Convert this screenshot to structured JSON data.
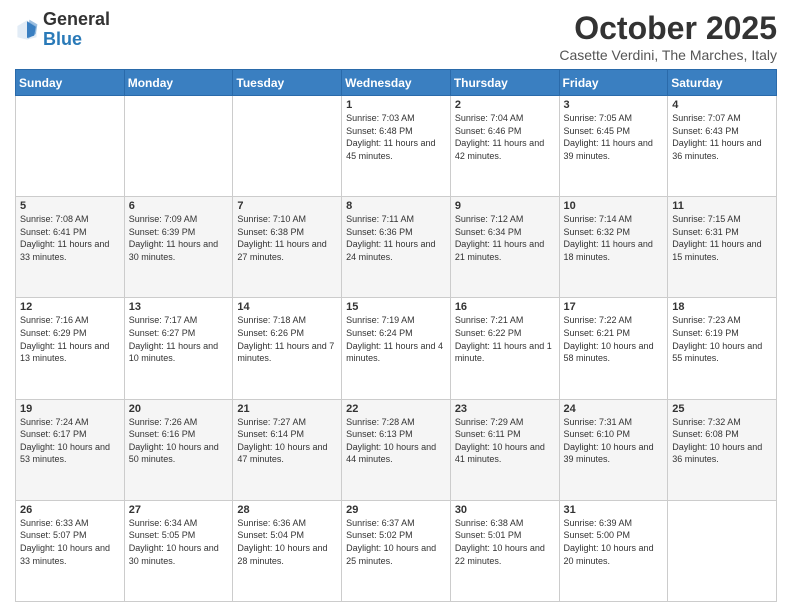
{
  "header": {
    "logo": {
      "line1": "General",
      "line2": "Blue"
    },
    "title": "October 2025",
    "location": "Casette Verdini, The Marches, Italy"
  },
  "days_of_week": [
    "Sunday",
    "Monday",
    "Tuesday",
    "Wednesday",
    "Thursday",
    "Friday",
    "Saturday"
  ],
  "weeks": [
    [
      {
        "day": "",
        "sunrise": "",
        "sunset": "",
        "daylight": ""
      },
      {
        "day": "",
        "sunrise": "",
        "sunset": "",
        "daylight": ""
      },
      {
        "day": "",
        "sunrise": "",
        "sunset": "",
        "daylight": ""
      },
      {
        "day": "1",
        "sunrise": "Sunrise: 7:03 AM",
        "sunset": "Sunset: 6:48 PM",
        "daylight": "Daylight: 11 hours and 45 minutes."
      },
      {
        "day": "2",
        "sunrise": "Sunrise: 7:04 AM",
        "sunset": "Sunset: 6:46 PM",
        "daylight": "Daylight: 11 hours and 42 minutes."
      },
      {
        "day": "3",
        "sunrise": "Sunrise: 7:05 AM",
        "sunset": "Sunset: 6:45 PM",
        "daylight": "Daylight: 11 hours and 39 minutes."
      },
      {
        "day": "4",
        "sunrise": "Sunrise: 7:07 AM",
        "sunset": "Sunset: 6:43 PM",
        "daylight": "Daylight: 11 hours and 36 minutes."
      }
    ],
    [
      {
        "day": "5",
        "sunrise": "Sunrise: 7:08 AM",
        "sunset": "Sunset: 6:41 PM",
        "daylight": "Daylight: 11 hours and 33 minutes."
      },
      {
        "day": "6",
        "sunrise": "Sunrise: 7:09 AM",
        "sunset": "Sunset: 6:39 PM",
        "daylight": "Daylight: 11 hours and 30 minutes."
      },
      {
        "day": "7",
        "sunrise": "Sunrise: 7:10 AM",
        "sunset": "Sunset: 6:38 PM",
        "daylight": "Daylight: 11 hours and 27 minutes."
      },
      {
        "day": "8",
        "sunrise": "Sunrise: 7:11 AM",
        "sunset": "Sunset: 6:36 PM",
        "daylight": "Daylight: 11 hours and 24 minutes."
      },
      {
        "day": "9",
        "sunrise": "Sunrise: 7:12 AM",
        "sunset": "Sunset: 6:34 PM",
        "daylight": "Daylight: 11 hours and 21 minutes."
      },
      {
        "day": "10",
        "sunrise": "Sunrise: 7:14 AM",
        "sunset": "Sunset: 6:32 PM",
        "daylight": "Daylight: 11 hours and 18 minutes."
      },
      {
        "day": "11",
        "sunrise": "Sunrise: 7:15 AM",
        "sunset": "Sunset: 6:31 PM",
        "daylight": "Daylight: 11 hours and 15 minutes."
      }
    ],
    [
      {
        "day": "12",
        "sunrise": "Sunrise: 7:16 AM",
        "sunset": "Sunset: 6:29 PM",
        "daylight": "Daylight: 11 hours and 13 minutes."
      },
      {
        "day": "13",
        "sunrise": "Sunrise: 7:17 AM",
        "sunset": "Sunset: 6:27 PM",
        "daylight": "Daylight: 11 hours and 10 minutes."
      },
      {
        "day": "14",
        "sunrise": "Sunrise: 7:18 AM",
        "sunset": "Sunset: 6:26 PM",
        "daylight": "Daylight: 11 hours and 7 minutes."
      },
      {
        "day": "15",
        "sunrise": "Sunrise: 7:19 AM",
        "sunset": "Sunset: 6:24 PM",
        "daylight": "Daylight: 11 hours and 4 minutes."
      },
      {
        "day": "16",
        "sunrise": "Sunrise: 7:21 AM",
        "sunset": "Sunset: 6:22 PM",
        "daylight": "Daylight: 11 hours and 1 minute."
      },
      {
        "day": "17",
        "sunrise": "Sunrise: 7:22 AM",
        "sunset": "Sunset: 6:21 PM",
        "daylight": "Daylight: 10 hours and 58 minutes."
      },
      {
        "day": "18",
        "sunrise": "Sunrise: 7:23 AM",
        "sunset": "Sunset: 6:19 PM",
        "daylight": "Daylight: 10 hours and 55 minutes."
      }
    ],
    [
      {
        "day": "19",
        "sunrise": "Sunrise: 7:24 AM",
        "sunset": "Sunset: 6:17 PM",
        "daylight": "Daylight: 10 hours and 53 minutes."
      },
      {
        "day": "20",
        "sunrise": "Sunrise: 7:26 AM",
        "sunset": "Sunset: 6:16 PM",
        "daylight": "Daylight: 10 hours and 50 minutes."
      },
      {
        "day": "21",
        "sunrise": "Sunrise: 7:27 AM",
        "sunset": "Sunset: 6:14 PM",
        "daylight": "Daylight: 10 hours and 47 minutes."
      },
      {
        "day": "22",
        "sunrise": "Sunrise: 7:28 AM",
        "sunset": "Sunset: 6:13 PM",
        "daylight": "Daylight: 10 hours and 44 minutes."
      },
      {
        "day": "23",
        "sunrise": "Sunrise: 7:29 AM",
        "sunset": "Sunset: 6:11 PM",
        "daylight": "Daylight: 10 hours and 41 minutes."
      },
      {
        "day": "24",
        "sunrise": "Sunrise: 7:31 AM",
        "sunset": "Sunset: 6:10 PM",
        "daylight": "Daylight: 10 hours and 39 minutes."
      },
      {
        "day": "25",
        "sunrise": "Sunrise: 7:32 AM",
        "sunset": "Sunset: 6:08 PM",
        "daylight": "Daylight: 10 hours and 36 minutes."
      }
    ],
    [
      {
        "day": "26",
        "sunrise": "Sunrise: 6:33 AM",
        "sunset": "Sunset: 5:07 PM",
        "daylight": "Daylight: 10 hours and 33 minutes."
      },
      {
        "day": "27",
        "sunrise": "Sunrise: 6:34 AM",
        "sunset": "Sunset: 5:05 PM",
        "daylight": "Daylight: 10 hours and 30 minutes."
      },
      {
        "day": "28",
        "sunrise": "Sunrise: 6:36 AM",
        "sunset": "Sunset: 5:04 PM",
        "daylight": "Daylight: 10 hours and 28 minutes."
      },
      {
        "day": "29",
        "sunrise": "Sunrise: 6:37 AM",
        "sunset": "Sunset: 5:02 PM",
        "daylight": "Daylight: 10 hours and 25 minutes."
      },
      {
        "day": "30",
        "sunrise": "Sunrise: 6:38 AM",
        "sunset": "Sunset: 5:01 PM",
        "daylight": "Daylight: 10 hours and 22 minutes."
      },
      {
        "day": "31",
        "sunrise": "Sunrise: 6:39 AM",
        "sunset": "Sunset: 5:00 PM",
        "daylight": "Daylight: 10 hours and 20 minutes."
      },
      {
        "day": "",
        "sunrise": "",
        "sunset": "",
        "daylight": ""
      }
    ]
  ]
}
